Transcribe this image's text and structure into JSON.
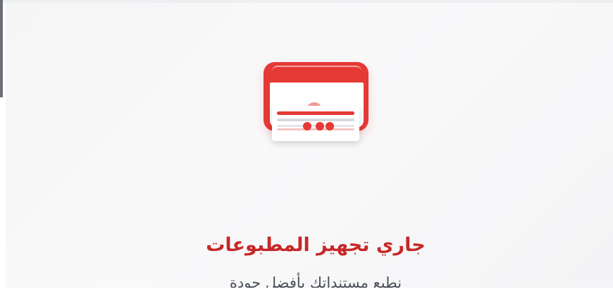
{
  "loading": {
    "title": "جاري تجهيز المطبوعات",
    "subtitle": "نطبع مستنداتك بأفضل جودة",
    "illustration_icon": "printer-icon"
  },
  "colors": {
    "accent": "#e53935",
    "title_text": "#c62828",
    "subtitle_text": "#4a4f58",
    "panel_background": "#f6f6f7"
  }
}
